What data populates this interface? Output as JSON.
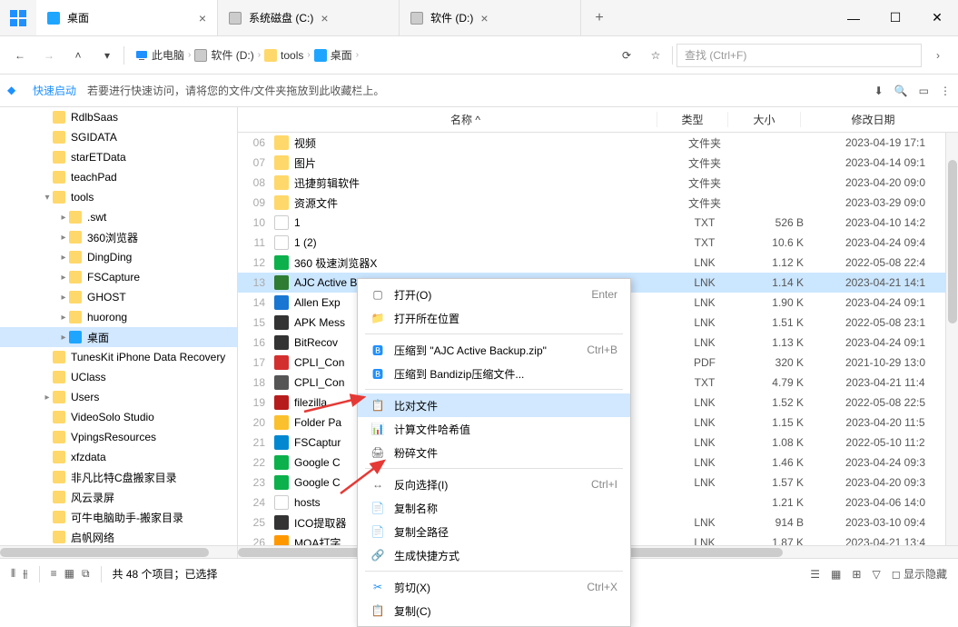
{
  "tabs": [
    {
      "icon": "desktop",
      "label": "桌面",
      "active": true
    },
    {
      "icon": "sysdisk",
      "label": "系统磁盘 (C:)",
      "active": false
    },
    {
      "icon": "soft",
      "label": "软件 (D:)",
      "active": false
    }
  ],
  "breadcrumb": [
    {
      "icon": "pc",
      "label": "此电脑"
    },
    {
      "icon": "drive",
      "label": "软件 (D:)"
    },
    {
      "icon": "folder",
      "label": "tools"
    },
    {
      "icon": "desktop",
      "label": "桌面"
    }
  ],
  "search_placeholder": "查找 (Ctrl+F)",
  "quickbar": {
    "label": "快速启动",
    "hint": "若要进行快速访问，请将您的文件/文件夹拖放到此收藏栏上。"
  },
  "tree": [
    {
      "d": 2,
      "exp": "",
      "label": "RdlbSaas"
    },
    {
      "d": 2,
      "exp": "",
      "label": "SGIDATA"
    },
    {
      "d": 2,
      "exp": "",
      "label": "starETData"
    },
    {
      "d": 2,
      "exp": "",
      "label": "teachPad"
    },
    {
      "d": 2,
      "exp": "▾",
      "label": "tools"
    },
    {
      "d": 3,
      "exp": "▸",
      "label": ".swt"
    },
    {
      "d": 3,
      "exp": "▸",
      "label": "360浏览器"
    },
    {
      "d": 3,
      "exp": "▸",
      "label": "DingDing"
    },
    {
      "d": 3,
      "exp": "▸",
      "label": "FSCapture"
    },
    {
      "d": 3,
      "exp": "▸",
      "label": "GHOST"
    },
    {
      "d": 3,
      "exp": "▸",
      "label": "huorong"
    },
    {
      "d": 3,
      "exp": "▸",
      "label": "桌面",
      "selected": true,
      "desktop": true
    },
    {
      "d": 2,
      "exp": "",
      "label": "TunesKit iPhone Data Recovery"
    },
    {
      "d": 2,
      "exp": "",
      "label": "UClass"
    },
    {
      "d": 2,
      "exp": "▸",
      "label": "Users"
    },
    {
      "d": 2,
      "exp": "",
      "label": "VideoSolo Studio"
    },
    {
      "d": 2,
      "exp": "",
      "label": "VpingsResources"
    },
    {
      "d": 2,
      "exp": "",
      "label": "xfzdata"
    },
    {
      "d": 2,
      "exp": "",
      "label": "非凡比特C盘搬家目录"
    },
    {
      "d": 2,
      "exp": "",
      "label": "风云录屏"
    },
    {
      "d": 2,
      "exp": "",
      "label": "可牛电脑助手-搬家目录"
    },
    {
      "d": 2,
      "exp": "",
      "label": "启帆网络"
    }
  ],
  "columns": {
    "name": "名称 ^",
    "type": "类型",
    "size": "大小",
    "date": "修改日期"
  },
  "rows": [
    {
      "n": "06",
      "icon": "folder",
      "name": "视频",
      "type": "文件夹",
      "size": "",
      "date": "2023-04-19  17:1"
    },
    {
      "n": "07",
      "icon": "folder",
      "name": "图片",
      "type": "文件夹",
      "size": "",
      "date": "2023-04-14  09:1"
    },
    {
      "n": "08",
      "icon": "folder",
      "name": "迅捷剪辑软件",
      "type": "文件夹",
      "size": "",
      "date": "2023-04-20  09:0"
    },
    {
      "n": "09",
      "icon": "folder",
      "name": "资源文件",
      "type": "文件夹",
      "size": "",
      "date": "2023-03-29  09:0"
    },
    {
      "n": "10",
      "icon": "file",
      "name": "1",
      "type": "TXT",
      "size": "526 B",
      "date": "2023-04-10  14:2"
    },
    {
      "n": "11",
      "icon": "file",
      "name": "1 (2)",
      "type": "TXT",
      "size": "10.6 K",
      "date": "2023-04-24  09:4"
    },
    {
      "n": "12",
      "icon": "app",
      "name": "360 极速浏览器X",
      "type": "LNK",
      "size": "1.12 K",
      "date": "2022-05-08  22:4",
      "iconColor": "#0cb14b"
    },
    {
      "n": "13",
      "icon": "app",
      "name": "AJC Active Backup",
      "type": "LNK",
      "size": "1.14 K",
      "date": "2023-04-21  14:1",
      "selected": true,
      "iconColor": "#2e7d32"
    },
    {
      "n": "14",
      "icon": "app",
      "name": "Allen Exp",
      "type": "LNK",
      "size": "1.90 K",
      "date": "2023-04-24  09:1",
      "iconColor": "#1976d2"
    },
    {
      "n": "15",
      "icon": "app",
      "name": "APK Mess",
      "type": "LNK",
      "size": "1.51 K",
      "date": "2022-05-08  23:1",
      "iconColor": "#333"
    },
    {
      "n": "16",
      "icon": "app",
      "name": "BitRecov",
      "type": "LNK",
      "size": "1.13 K",
      "date": "2023-04-24  09:1",
      "iconColor": "#333"
    },
    {
      "n": "17",
      "icon": "app",
      "name": "CPLI_Con",
      "type": "PDF",
      "size": "320 K",
      "date": "2021-10-29  13:0",
      "iconColor": "#d32f2f"
    },
    {
      "n": "18",
      "icon": "app",
      "name": "CPLI_Con",
      "type": "TXT",
      "size": "4.79 K",
      "date": "2023-04-21  11:4",
      "iconColor": "#555"
    },
    {
      "n": "19",
      "icon": "app",
      "name": "filezilla",
      "type": "LNK",
      "size": "1.52 K",
      "date": "2022-05-08  22:5",
      "iconColor": "#b71c1c"
    },
    {
      "n": "20",
      "icon": "app",
      "name": "Folder Pa",
      "type": "LNK",
      "size": "1.15 K",
      "date": "2023-04-20  11:5",
      "iconColor": "#fbc02d"
    },
    {
      "n": "21",
      "icon": "app",
      "name": "FSCaptur",
      "type": "LNK",
      "size": "1.08 K",
      "date": "2022-05-10  11:2",
      "iconColor": "#0288d1"
    },
    {
      "n": "22",
      "icon": "app",
      "name": "Google C",
      "type": "LNK",
      "size": "1.46 K",
      "date": "2023-04-24  09:3",
      "iconColor": "#0cb14b"
    },
    {
      "n": "23",
      "icon": "app",
      "name": "Google C",
      "type": "LNK",
      "size": "1.57 K",
      "date": "2023-04-20  09:3",
      "iconColor": "#0cb14b"
    },
    {
      "n": "24",
      "icon": "file",
      "name": "hosts",
      "type": "",
      "size": "1.21 K",
      "date": "2023-04-06  14:0"
    },
    {
      "n": "25",
      "icon": "app",
      "name": "ICO提取器",
      "type": "LNK",
      "size": "914 B",
      "date": "2023-03-10  09:4",
      "iconColor": "#333"
    },
    {
      "n": "26",
      "icon": "app",
      "name": "MOA打字",
      "type": "LNK",
      "size": "1.87 K",
      "date": "2023-04-21  13:4",
      "iconColor": "#ff9800"
    }
  ],
  "context_menu": [
    {
      "icon": "open",
      "label": "打开(O)",
      "shortcut": "Enter"
    },
    {
      "icon": "location",
      "label": "打开所在位置"
    },
    {
      "sep": true
    },
    {
      "icon": "zip",
      "label": "压缩到 \"AJC Active Backup.zip\"",
      "shortcut": "Ctrl+B"
    },
    {
      "icon": "zip",
      "label": "压缩到 Bandizip压缩文件..."
    },
    {
      "sep": true
    },
    {
      "icon": "compare",
      "label": "比对文件",
      "hover": true
    },
    {
      "icon": "hash",
      "label": "计算文件哈希值"
    },
    {
      "icon": "shred",
      "label": "粉碎文件"
    },
    {
      "sep": true
    },
    {
      "icon": "invert",
      "label": "反向选择(I)",
      "shortcut": "Ctrl+I"
    },
    {
      "icon": "copyname",
      "label": "复制名称"
    },
    {
      "icon": "copypath",
      "label": "复制全路径"
    },
    {
      "icon": "shortcut",
      "label": "生成快捷方式"
    },
    {
      "sep": true
    },
    {
      "icon": "cut",
      "label": "剪切(X)",
      "shortcut": "Ctrl+X"
    },
    {
      "icon": "copy",
      "label": "复制(C)"
    }
  ],
  "statusbar": {
    "text": "共 48 个项目；已选择",
    "show_hidden": "显示隐藏"
  }
}
